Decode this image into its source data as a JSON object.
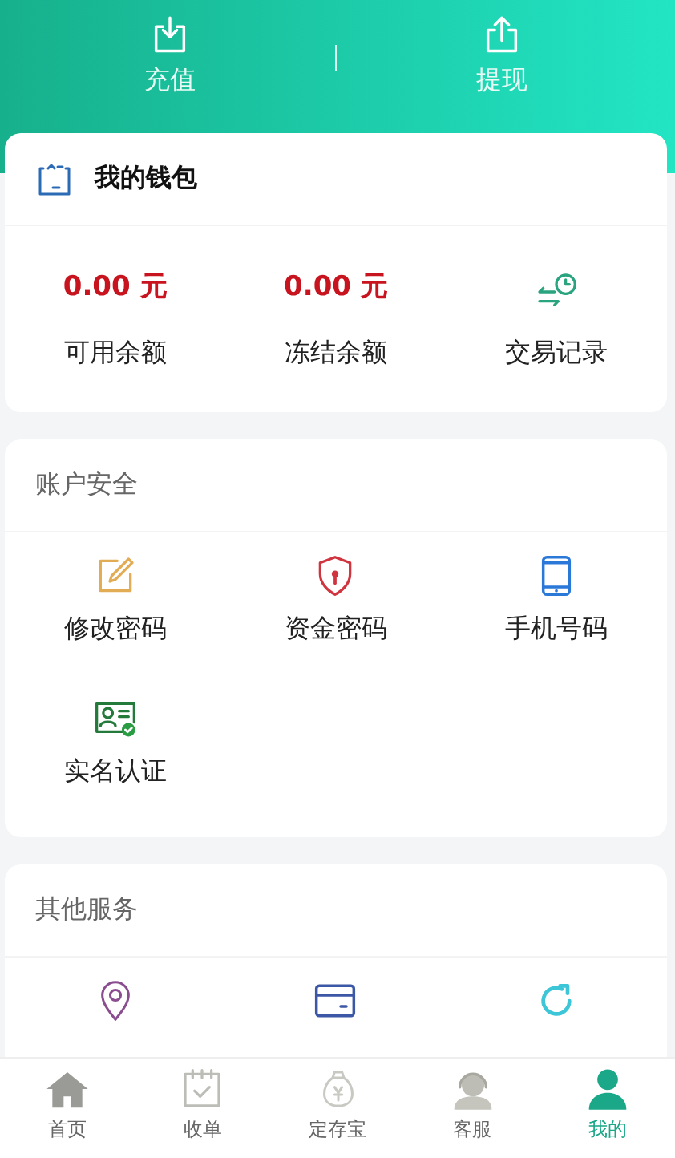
{
  "header_actions": [
    {
      "label": "充值"
    },
    {
      "label": "提现"
    }
  ],
  "wallet": {
    "title": "我的钱包",
    "balances": [
      {
        "amount": "0.00 元",
        "label": "可用余额"
      },
      {
        "amount": "0.00 元",
        "label": "冻结余额"
      }
    ],
    "records": {
      "label": "交易记录"
    }
  },
  "sections": [
    {
      "title": "账户安全",
      "items": [
        {
          "label": "修改密码"
        },
        {
          "label": "资金密码"
        },
        {
          "label": "手机号码"
        },
        {
          "label": "实名认证"
        }
      ]
    },
    {
      "title": "其他服务"
    }
  ],
  "tab_bar": [
    {
      "label": "首页",
      "selected": false
    },
    {
      "label": "收单",
      "selected": false
    },
    {
      "label": "定存宝",
      "selected": false
    },
    {
      "label": "客服",
      "selected": false
    },
    {
      "label": "我的",
      "selected": true
    }
  ]
}
